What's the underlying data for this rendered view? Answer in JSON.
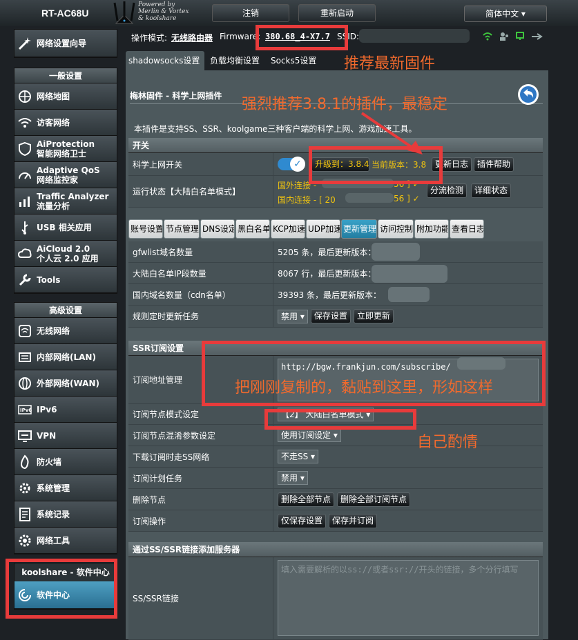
{
  "header": {
    "model": "RT-AC68U",
    "powered_by": [
      "Powered by",
      "Merlin & Vortex",
      "& koolshare"
    ],
    "logout": "注销",
    "reboot": "重新启动",
    "language": "简体中文 ▾"
  },
  "status": {
    "mode_label": "操作模式:",
    "mode_value": "无线路由器",
    "firmware_label": "Firmware:",
    "firmware_value": "380.68_4-X7.7",
    "ssid_label": "SSID:"
  },
  "top_tabs": [
    "shadowsocks设置",
    "负载均衡设置",
    "Socks5设置"
  ],
  "sidebar": {
    "setup_wizard": "网络设置向导",
    "general_header": "一般设置",
    "general_items": [
      {
        "label": "网络地图",
        "icon": "network-map-icon"
      },
      {
        "label": "访客网络",
        "icon": "guest-network-icon"
      },
      {
        "label": "AiProtection",
        "label2": "智能网络卫士",
        "icon": "aiprotection-icon"
      },
      {
        "label": "Adaptive QoS",
        "label2": "网络监控家",
        "icon": "qos-icon"
      },
      {
        "label": "Traffic Analyzer",
        "label2": "流量分析",
        "icon": "traffic-icon"
      },
      {
        "label": "USB 相关应用",
        "icon": "usb-icon"
      },
      {
        "label": "AiCloud 2.0",
        "label2": "个人云 2.0 应用",
        "icon": "cloud-icon"
      },
      {
        "label": "Tools",
        "icon": "wrench-icon"
      }
    ],
    "advanced_header": "高级设置",
    "advanced_items": [
      {
        "label": "无线网络",
        "icon": "wireless-icon"
      },
      {
        "label": "内部网络(LAN)",
        "icon": "lan-icon"
      },
      {
        "label": "外部网络(WAN)",
        "icon": "wan-icon"
      },
      {
        "label": "IPv6",
        "icon": "ipv6-icon"
      },
      {
        "label": "VPN",
        "icon": "vpn-icon"
      },
      {
        "label": "防火墙",
        "icon": "firewall-icon"
      },
      {
        "label": "系统管理",
        "icon": "admin-icon"
      },
      {
        "label": "系统记录",
        "icon": "log-icon"
      },
      {
        "label": "网络工具",
        "icon": "network-tools-icon"
      }
    ],
    "koolshare_header": "koolshare - 软件中心",
    "software_center": "软件中心"
  },
  "panel": {
    "title": "梅林固件 - 科学上网插件",
    "description": "本插件是支持SS、SSR、koolgame三种客户端的科学上网、游戏加速工具。",
    "switch_section": "开关",
    "switch_label": "科学上网开关",
    "upgrade_text": "升级到：3.8.4",
    "current_version": "当前版本：3.8",
    "update_log": "更新日志",
    "plugin_help": "插件帮助",
    "run_status_label": "运行状态【大陆白名单模式】",
    "foreign_conn": "国外连接 - [",
    "foreign_tail": "56 ] ✓",
    "domestic_conn": "国内连接 - [ 20",
    "domestic_tail": "56 ] ✓",
    "split_check": "分流检测",
    "detail_status": "详细状态",
    "sub_tabs": [
      "账号设置",
      "节点管理",
      "DNS设定",
      "黑白名单",
      "KCP加速",
      "UDP加速",
      "更新管理",
      "访问控制",
      "附加功能",
      "查看日志"
    ],
    "gfwlist_label": "gfwlist域名数量",
    "gfwlist_value": "5205 条，最后更新版本：",
    "china_ip_label": "大陆白名单IP段数量",
    "china_ip_value": "8067 行，最后更新版本：",
    "cdn_label": "国内域名数量（cdn名单）",
    "cdn_value": "39393 条，最后更新版本：",
    "rule_update_label": "规则定时更新任务",
    "rule_update_select": "禁用 ▾",
    "save_settings": "保存设置",
    "update_now": "立即更新"
  },
  "ssr": {
    "section": "SSR订阅设置",
    "url_label": "订阅地址管理",
    "url_value": "http://bgw.frankjun.com/subscribe/",
    "node_mode_label": "订阅节点模式设定",
    "node_mode_value": "【2】 大陆白名单模式 ▾",
    "obfs_label": "订阅节点混淆参数设定",
    "obfs_value": "使用订阅设定 ▾",
    "download_ss_label": "下载订阅时走SS网络",
    "download_ss_value": "不走SS ▾",
    "schedule_label": "订阅计划任务",
    "schedule_value": "禁用 ▾",
    "delete_label": "删除节点",
    "delete_all": "删除全部节点",
    "delete_sub": "删除全部订阅节点",
    "operation_label": "订阅操作",
    "save_only": "仅保存设置",
    "save_subscribe": "保存并订阅"
  },
  "link": {
    "section": "通过SS/SSR链接添加服务器",
    "label": "SS/SSR链接",
    "placeholder": "填入需要解析的以ss://或者ssr://开头的链接，多个分行填写"
  },
  "annotations": {
    "recommend_firmware": "推荐最新固件",
    "recommend_plugin": "强烈推荐3.8.1的插件，最稳定",
    "paste_here": "把刚刚复制的，黏贴到这里，形如这样",
    "your_choice": "自己酌情"
  },
  "colors": {
    "annotation": "#f26a2d",
    "highlight_box": "#e83b3b",
    "active_tab": "#2f90b6",
    "version_text": "#f1c40f"
  }
}
